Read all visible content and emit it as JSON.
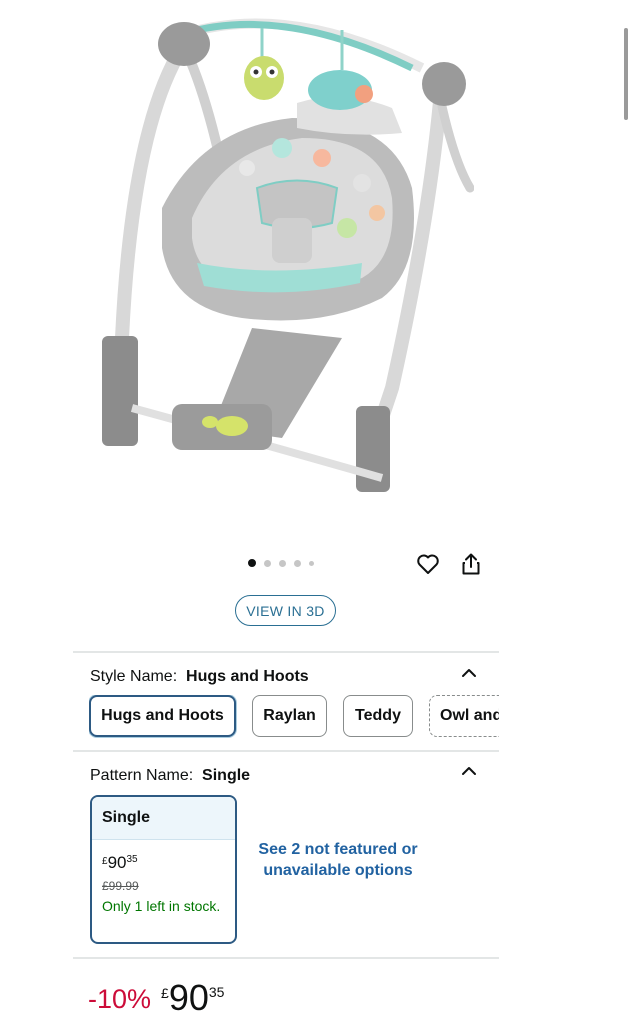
{
  "gallery": {
    "image_alt": "Portable baby swing with owl and elephant toys",
    "dots_count": 5,
    "active_dot": 0,
    "heart_icon": "heart-icon",
    "share_icon": "share-icon"
  },
  "view3d": {
    "label": "VIEW IN 3D"
  },
  "style": {
    "label": "Style Name:",
    "selected": "Hugs and Hoots",
    "options": [
      "Hugs and Hoots",
      "Raylan",
      "Teddy",
      "Owl and"
    ]
  },
  "pattern": {
    "label": "Pattern Name:",
    "selected": "Single",
    "card": {
      "name": "Single",
      "currency": "£",
      "price_whole": "90",
      "price_fraction": "35",
      "old_price": "£99.99",
      "stock": "Only 1 left in stock."
    },
    "see_more": "See 2 not featured or unavailable options"
  },
  "price": {
    "discount": "-10%",
    "currency": "£",
    "whole": "90",
    "fraction": "35"
  },
  "colors": {
    "accent_blue": "#2d5a83",
    "link_blue": "#2162a1",
    "discount_red": "#cc0c39",
    "stock_green": "#007600"
  }
}
